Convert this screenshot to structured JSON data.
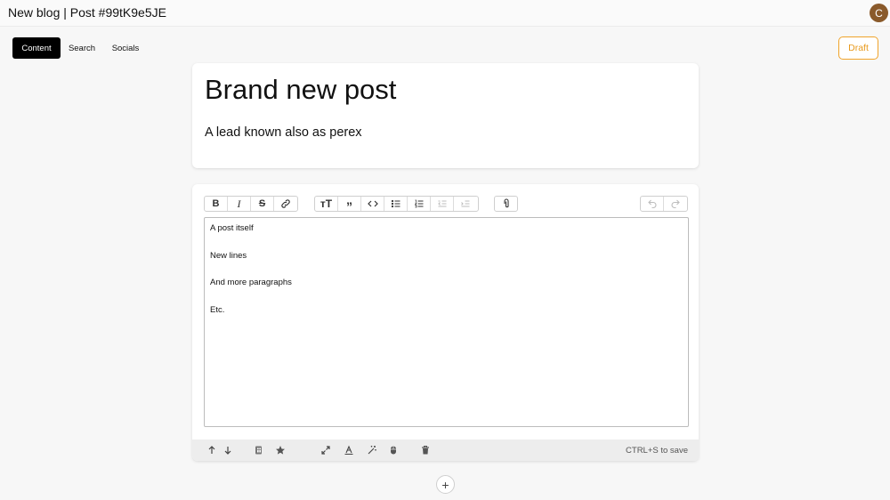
{
  "header": {
    "title": "New blog | Post #99tK9e5JE",
    "avatar_initial": "C"
  },
  "tabs": [
    {
      "label": "Content",
      "active": true
    },
    {
      "label": "Search",
      "active": false
    },
    {
      "label": "Socials",
      "active": false
    }
  ],
  "status_button": {
    "label": "Draft",
    "color": "#f0a32a"
  },
  "post": {
    "title": "Brand new post",
    "lead": "A lead known also as perex"
  },
  "editor": {
    "toolbar": {
      "group1": [
        "bold-icon",
        "italic-icon",
        "strikethrough-icon",
        "link-icon"
      ],
      "group2": [
        "heading-icon",
        "quote-icon",
        "code-icon",
        "bullet-list-icon",
        "numbered-list-icon",
        "outdent-icon",
        "indent-icon"
      ],
      "group3": [
        "attach-icon"
      ],
      "group4": [
        "undo-icon",
        "redo-icon"
      ]
    },
    "paragraphs": [
      "A post itself",
      "New lines",
      "And more paragraphs",
      "Etc."
    ]
  },
  "block_actions": {
    "icons": [
      "move-up-icon",
      "move-down-icon",
      "block-type-icon",
      "favorite-star-icon",
      "expand-icon",
      "text-style-icon",
      "magic-wand-icon",
      "mouse-icon",
      "delete-icon"
    ],
    "save_hint": "CTRL+S to save"
  },
  "add_block": {
    "label": "+"
  }
}
